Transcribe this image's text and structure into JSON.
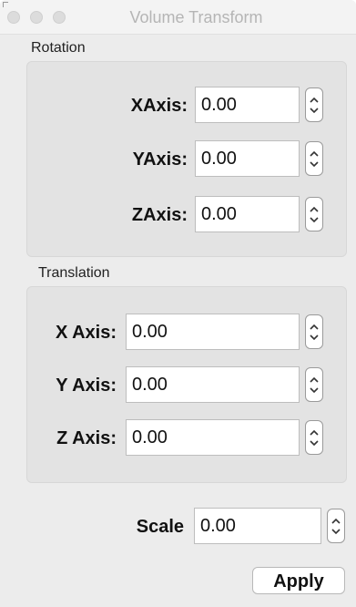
{
  "window": {
    "title": "Volume Transform"
  },
  "rotation": {
    "group_label": "Rotation",
    "fields": [
      {
        "label": "XAxis:",
        "value": "0.00"
      },
      {
        "label": "YAxis:",
        "value": "0.00"
      },
      {
        "label": "ZAxis:",
        "value": "0.00"
      }
    ]
  },
  "translation": {
    "group_label": "Translation",
    "fields": [
      {
        "label": "X Axis:",
        "value": "0.00"
      },
      {
        "label": "Y Axis:",
        "value": "0.00"
      },
      {
        "label": "Z Axis:",
        "value": "0.00"
      }
    ]
  },
  "scale": {
    "label": "Scale",
    "value": "0.00"
  },
  "actions": {
    "apply_label": "Apply"
  },
  "icons": {
    "stepper": "up-down-chevron-icon",
    "window_controls": [
      "close-icon",
      "minimize-icon",
      "zoom-icon"
    ]
  }
}
